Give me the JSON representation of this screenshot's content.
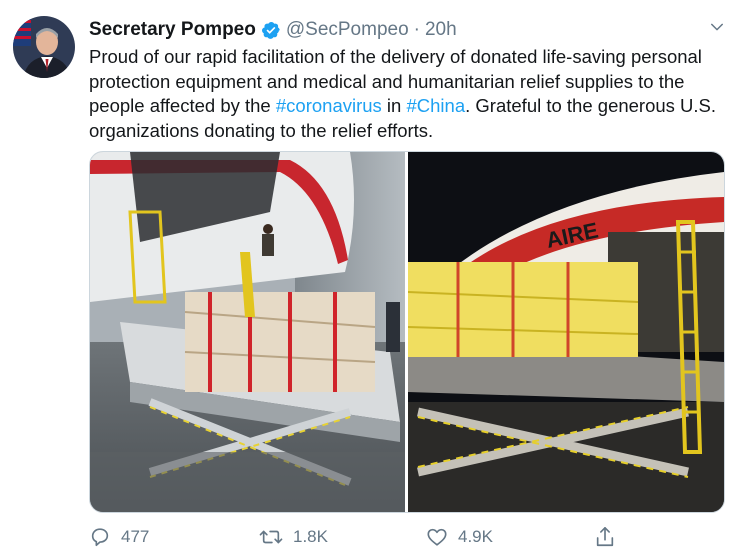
{
  "tweet": {
    "author_name": "Secretary Pompeo",
    "handle": "@SecPompeo",
    "separator": "·",
    "timestamp": "20h",
    "text": {
      "part1": "Proud of our rapid facilitation of the delivery of donated life-saving personal protection equipment and medical and humanitarian relief supplies to the people affected by the ",
      "hashtag1": "#coronavirus",
      "part2": " in ",
      "hashtag2": "#China",
      "part3": ". Grateful to the generous U.S. organizations donating to the relief efforts."
    }
  },
  "icons": {
    "verified": "verified-badge-icon",
    "caret": "chevron-down-icon",
    "reply": "reply-icon",
    "retweet": "retweet-icon",
    "like": "heart-icon",
    "share": "share-icon"
  },
  "actions": {
    "replies": "477",
    "retweets": "1.8K",
    "likes": "4.9K"
  },
  "colors": {
    "link": "#1da1f2",
    "secondary_text": "#657786",
    "border": "#ccd6dd"
  }
}
